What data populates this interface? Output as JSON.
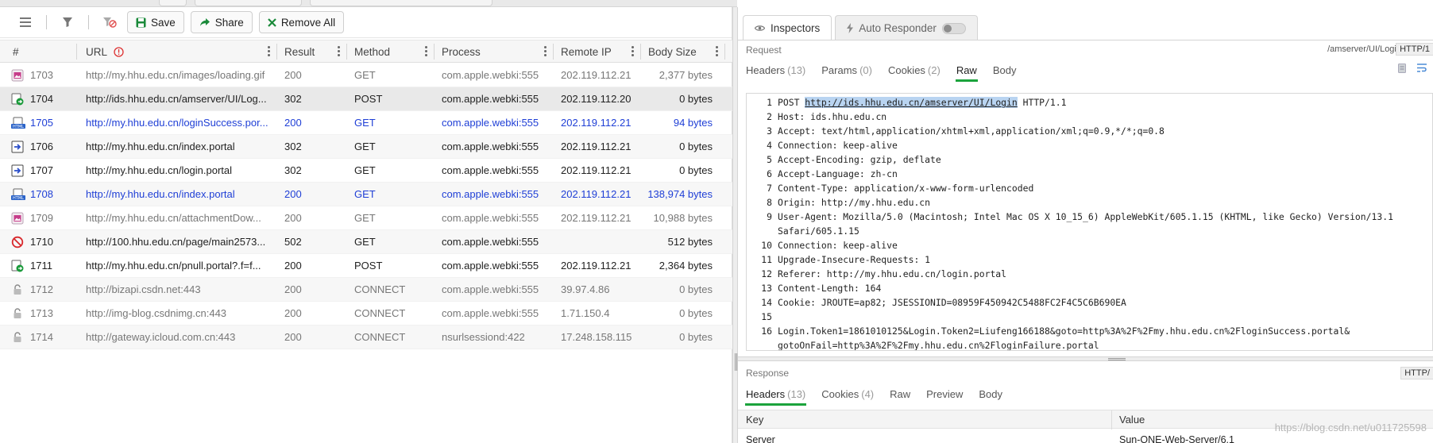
{
  "toolbar": {
    "save_label": "Save",
    "share_label": "Share",
    "remove_all_label": "Remove All"
  },
  "columns": {
    "num": "#",
    "url": "URL",
    "result": "Result",
    "method": "Method",
    "process": "Process",
    "remote_ip": "Remote IP",
    "body_size": "Body Size"
  },
  "rows": [
    {
      "icon": "image-icon",
      "num": "1703",
      "url": "http://my.hhu.edu.cn/images/loading.gif",
      "result": "200",
      "method": "GET",
      "process": "com.apple.webki:555",
      "ip": "202.119.112.21",
      "size": "2,377 bytes",
      "style": "gry"
    },
    {
      "icon": "redirect-icon",
      "num": "1704",
      "url": "http://ids.hhu.edu.cn/amserver/UI/Log...",
      "result": "302",
      "method": "POST",
      "process": "com.apple.webki:555",
      "ip": "202.119.112.20",
      "size": "0 bytes",
      "style": "blk"
    },
    {
      "icon": "html-icon",
      "num": "1705",
      "url": "http://my.hhu.edu.cn/loginSuccess.por...",
      "result": "200",
      "method": "GET",
      "process": "com.apple.webki:555",
      "ip": "202.119.112.21",
      "size": "94 bytes",
      "style": "blu"
    },
    {
      "icon": "redirect-arrow-icon",
      "num": "1706",
      "url": "http://my.hhu.edu.cn/index.portal",
      "result": "302",
      "method": "GET",
      "process": "com.apple.webki:555",
      "ip": "202.119.112.21",
      "size": "0 bytes",
      "style": "blk"
    },
    {
      "icon": "redirect-arrow-icon",
      "num": "1707",
      "url": "http://my.hhu.edu.cn/login.portal",
      "result": "302",
      "method": "GET",
      "process": "com.apple.webki:555",
      "ip": "202.119.112.21",
      "size": "0 bytes",
      "style": "blk"
    },
    {
      "icon": "html-icon",
      "num": "1708",
      "url": "http://my.hhu.edu.cn/index.portal",
      "result": "200",
      "method": "GET",
      "process": "com.apple.webki:555",
      "ip": "202.119.112.21",
      "size": "138,974 bytes",
      "style": "blu"
    },
    {
      "icon": "image-icon",
      "num": "1709",
      "url": "http://my.hhu.edu.cn/attachmentDow...",
      "result": "200",
      "method": "GET",
      "process": "com.apple.webki:555",
      "ip": "202.119.112.21",
      "size": "10,988 bytes",
      "style": "gry"
    },
    {
      "icon": "blocked-icon",
      "num": "1710",
      "url": "http://100.hhu.edu.cn/page/main2573...",
      "result": "502",
      "method": "GET",
      "process": "com.apple.webki:555",
      "ip": "",
      "size": "512 bytes",
      "style": "blk"
    },
    {
      "icon": "redirect-icon",
      "num": "1711",
      "url": "http://my.hhu.edu.cn/pnull.portal?.f=f...",
      "result": "200",
      "method": "POST",
      "process": "com.apple.webki:555",
      "ip": "202.119.112.21",
      "size": "2,364 bytes",
      "style": "blk"
    },
    {
      "icon": "lock-icon",
      "num": "1712",
      "url": "http://bizapi.csdn.net:443",
      "result": "200",
      "method": "CONNECT",
      "process": "com.apple.webki:555",
      "ip": "39.97.4.86",
      "size": "0 bytes",
      "style": "gry"
    },
    {
      "icon": "lock-icon",
      "num": "1713",
      "url": "http://img-blog.csdnimg.cn:443",
      "result": "200",
      "method": "CONNECT",
      "process": "com.apple.webki:555",
      "ip": "1.71.150.4",
      "size": "0 bytes",
      "style": "gry"
    },
    {
      "icon": "lock-icon",
      "num": "1714",
      "url": "http://gateway.icloud.com.cn:443",
      "result": "200",
      "method": "CONNECT",
      "process": "nsurlsessiond:422",
      "ip": "17.248.158.115",
      "size": "0 bytes",
      "style": "gry"
    }
  ],
  "inspector": {
    "tabs": {
      "inspectors": "Inspectors",
      "auto_responder": "Auto Responder"
    },
    "request_label": "Request",
    "request_path": "/amserver/UI/Login",
    "request_proto": "HTTP/1",
    "request_tabs": [
      {
        "label": "Headers",
        "count": "(13)"
      },
      {
        "label": "Params",
        "count": "(0)"
      },
      {
        "label": "Cookies",
        "count": "(2)"
      },
      {
        "label": "Raw",
        "count": ""
      },
      {
        "label": "Body",
        "count": ""
      }
    ],
    "raw_lines": {
      "l1_pre": "POST ",
      "l1_url": "http://ids.hhu.edu.cn/amserver/UI/Login",
      "l1_post": " HTTP/1.1",
      "l2": "Host: ids.hhu.edu.cn",
      "l3": "Accept: text/html,application/xhtml+xml,application/xml;q=0.9,*/*;q=0.8",
      "l4": "Connection: keep-alive",
      "l5": "Accept-Encoding: gzip, deflate",
      "l6": "Accept-Language: zh-cn",
      "l7": "Content-Type: application/x-www-form-urlencoded",
      "l8": "Origin: http://my.hhu.edu.cn",
      "l9": "User-Agent: Mozilla/5.0 (Macintosh; Intel Mac OS X 10_15_6) AppleWebKit/605.1.15 (KHTML, like Gecko) Version/13.1",
      "l9b": "Safari/605.1.15",
      "l10": "Connection: keep-alive",
      "l11": "Upgrade-Insecure-Requests: 1",
      "l12": "Referer: http://my.hhu.edu.cn/login.portal",
      "l13": "Content-Length: 164",
      "l14": "Cookie: JROUTE=ap82; JSESSIONID=08959F450942C5488FC2F4C5C6B690EA",
      "l15": "",
      "l16": "Login.Token1=1861010125&Login.Token2=Liufeng166188&goto=http%3A%2F%2Fmy.hhu.edu.cn%2FloginSuccess.portal&",
      "l16b": "gotoOnFail=http%3A%2F%2Fmy.hhu.edu.cn%2FloginFailure.portal"
    },
    "response_label": "Response",
    "response_proto": "HTTP/",
    "response_tabs": [
      {
        "label": "Headers",
        "count": "(13)"
      },
      {
        "label": "Cookies",
        "count": "(4)"
      },
      {
        "label": "Raw",
        "count": ""
      },
      {
        "label": "Preview",
        "count": ""
      },
      {
        "label": "Body",
        "count": ""
      }
    ],
    "kv_header": {
      "key": "Key",
      "value": "Value"
    },
    "kv_rows": [
      {
        "key": "Server",
        "value": "Sun-ONE-Web-Server/6.1"
      }
    ]
  },
  "watermark": "https://blog.csdn.net/u011725598",
  "colors": {
    "accent_green": "#1ba33c",
    "link_blue": "#1f3fd6",
    "selection": "#b9d4f1"
  }
}
